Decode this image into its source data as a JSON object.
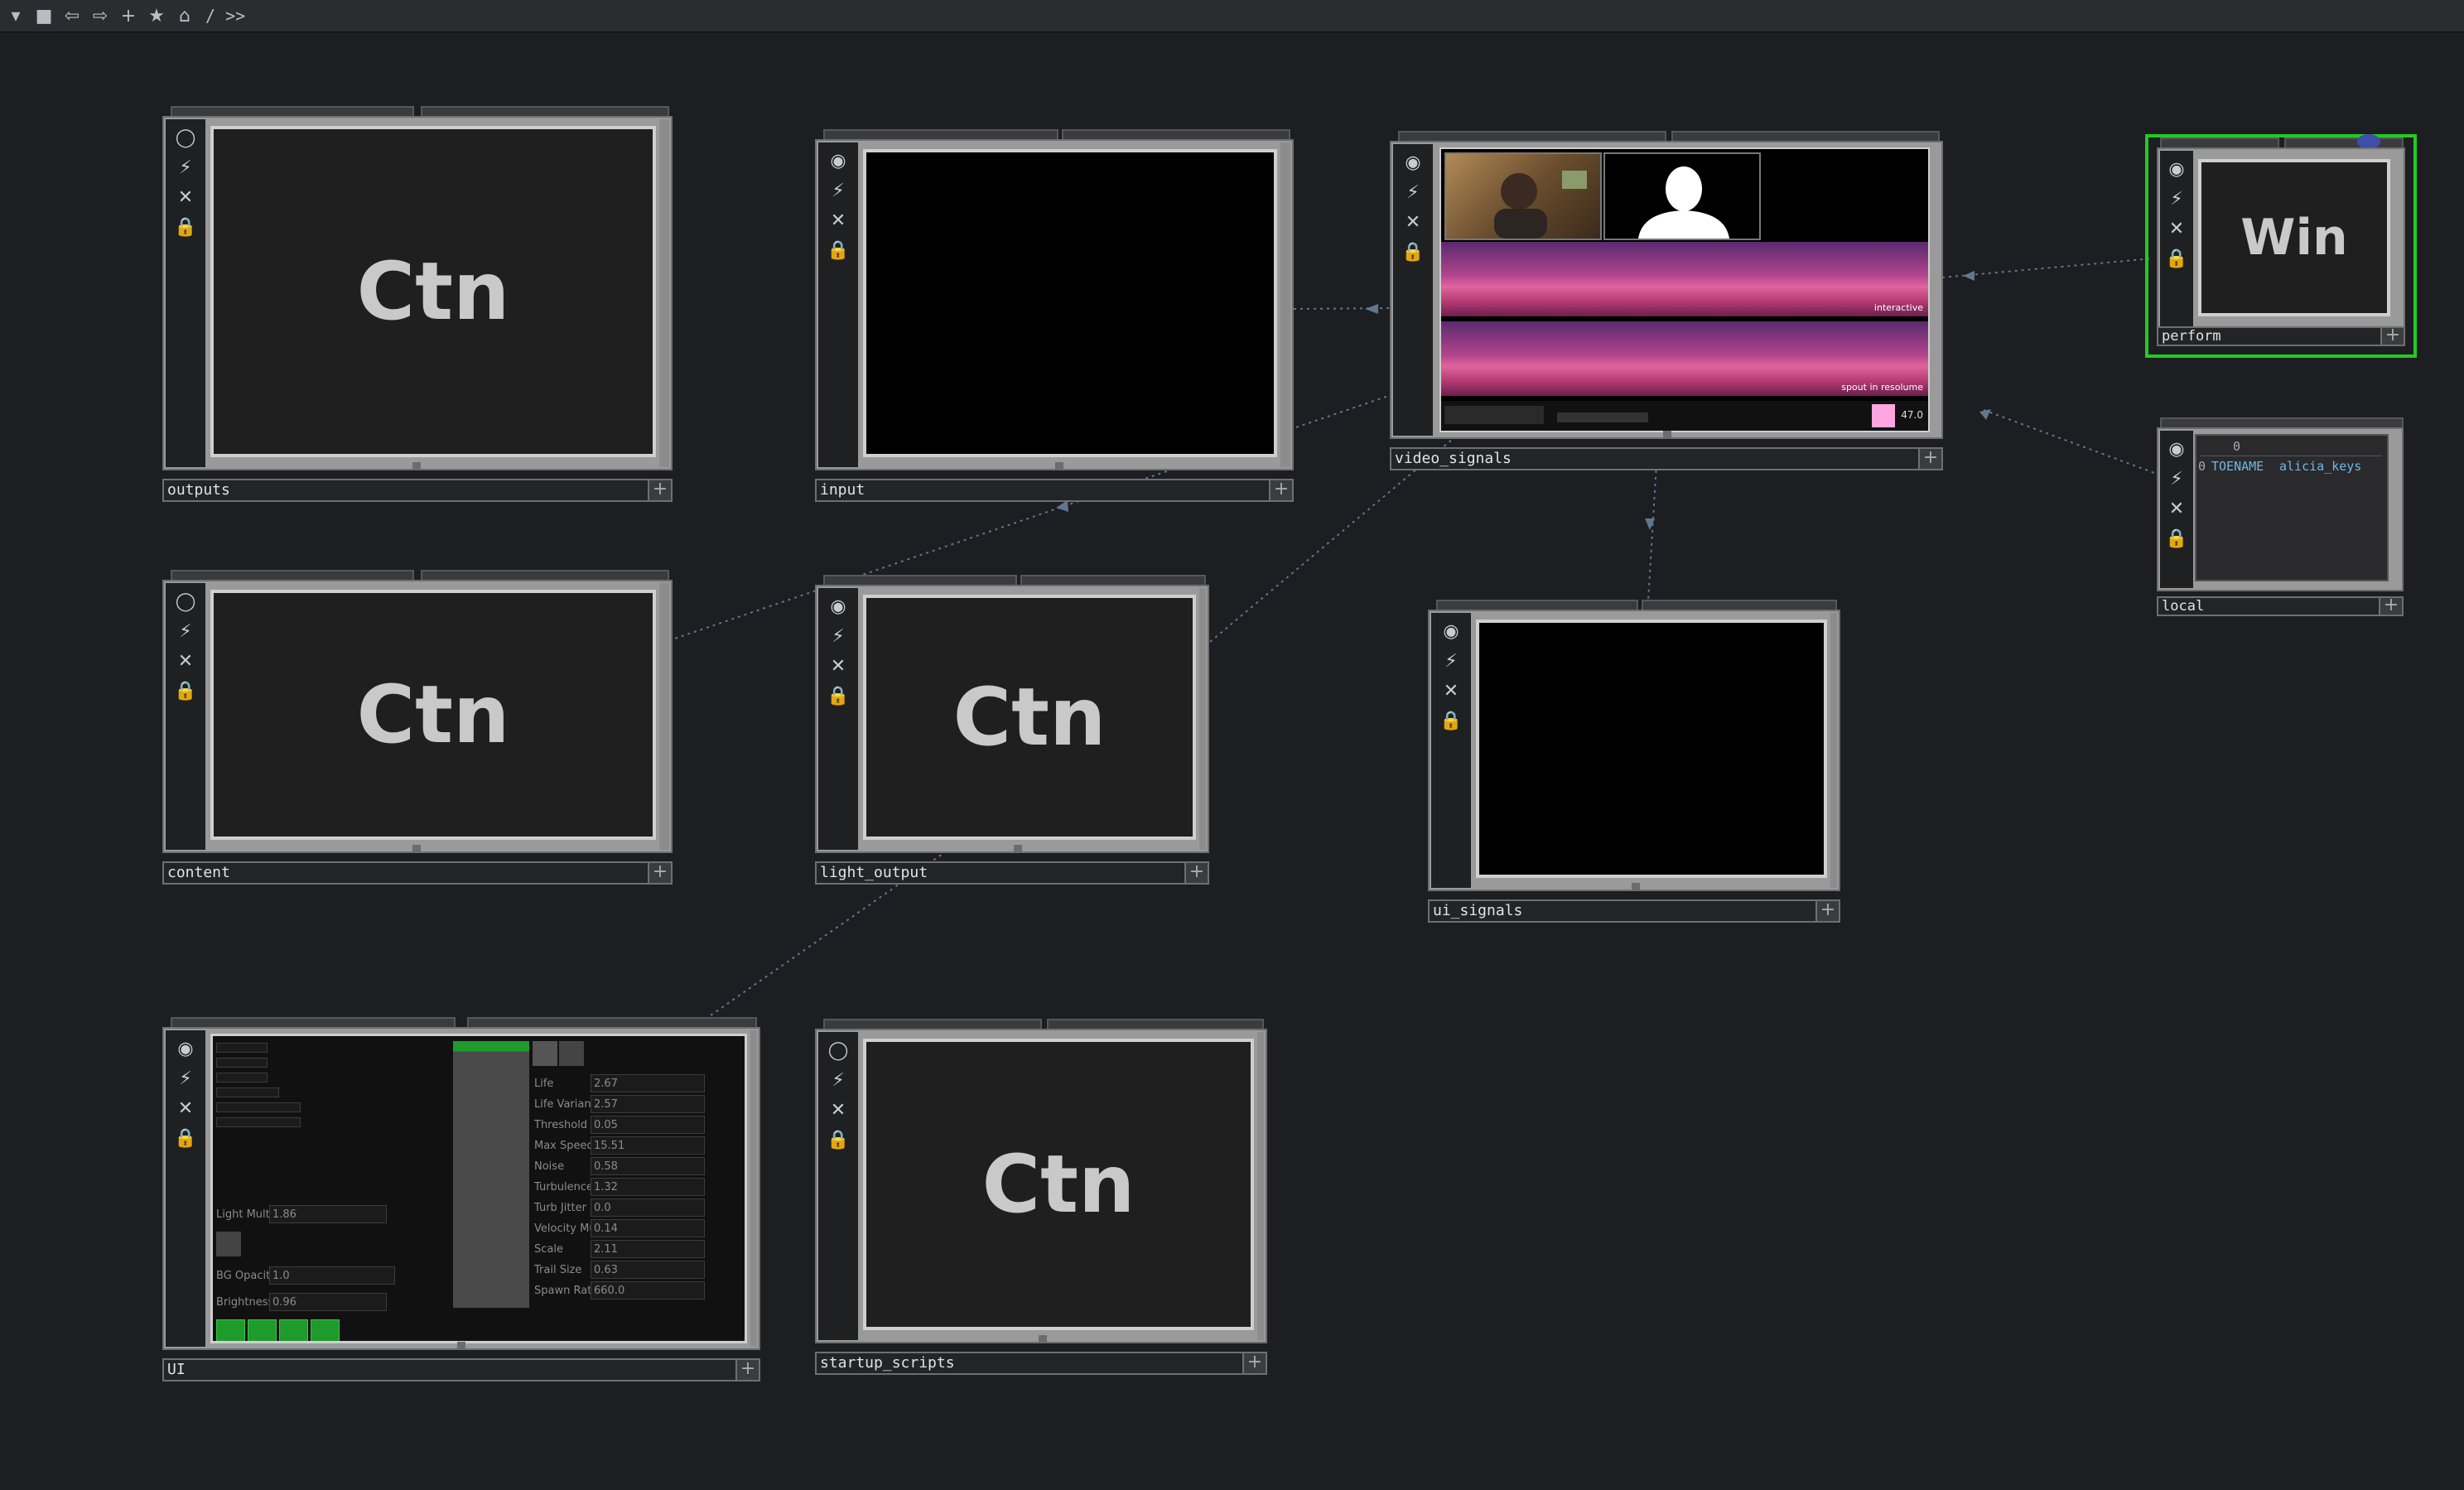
{
  "toolbar": {
    "items": [
      "▾",
      "■",
      "⇦",
      "⇨",
      "+",
      "★",
      "⌂"
    ],
    "path": "/ >>"
  },
  "icons": {
    "viewer": "circle-icon",
    "cook": "lightning-icon",
    "bypass": "x-icon",
    "lock": "lock-icon"
  },
  "nodes": {
    "outputs": {
      "name": "outputs",
      "text": "Ctn"
    },
    "input": {
      "name": "input"
    },
    "video_signals": {
      "name": "video_signals",
      "scene1": "interactive",
      "scene2": "spout in resolume",
      "value": "47.0",
      "swatch": "#ffa6e0"
    },
    "perform": {
      "name": "perform",
      "text": "Win"
    },
    "local": {
      "name": "local",
      "header": "0",
      "row_index": "0",
      "key": "TOENAME",
      "value": "alicia_keys"
    },
    "content": {
      "name": "content",
      "text": "Ctn"
    },
    "light_output": {
      "name": "light_output",
      "text": "Ctn"
    },
    "ui_signals": {
      "name": "ui_signals"
    },
    "ui": {
      "name": "UI",
      "light_mult": {
        "label": "Light Mult",
        "value": "1.86"
      },
      "bg_opacity": {
        "label": "BG Opacity",
        "value": "1.0"
      },
      "brightness": {
        "label": "Brightness",
        "value": "0.96"
      },
      "params": [
        {
          "label": "Life",
          "value": "2.67"
        },
        {
          "label": "Life Variance",
          "value": "2.57"
        },
        {
          "label": "Threshold",
          "value": "0.05"
        },
        {
          "label": "Max Speed",
          "value": "15.51"
        },
        {
          "label": "Noise",
          "value": "0.58"
        },
        {
          "label": "Turbulence",
          "value": "1.32"
        },
        {
          "label": "Turb Jitter",
          "value": "0.0"
        },
        {
          "label": "Velocity Mult",
          "value": "0.14"
        },
        {
          "label": "Scale",
          "value": "2.11"
        },
        {
          "label": "Trail Size",
          "value": "0.63"
        },
        {
          "label": "Spawn Rate",
          "value": "660.0"
        }
      ]
    },
    "startup_scripts": {
      "name": "startup_scripts",
      "text": "Ctn"
    }
  },
  "colors": {
    "background": "#1d1e21",
    "selected_outline": "#22cc22",
    "table_text": "#6fb8e8"
  }
}
